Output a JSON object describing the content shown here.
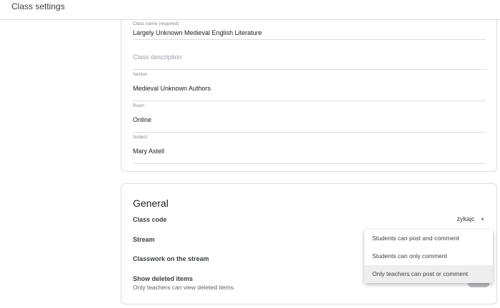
{
  "header": {
    "title": "Class settings"
  },
  "details": {
    "fields": [
      {
        "label": "Class name (required)",
        "value": "Largely Unknown Medieval English Literature"
      },
      {
        "label": "",
        "placeholder": "Class description"
      },
      {
        "label": "Section",
        "value": "Medieval Unknown Authors"
      },
      {
        "label": "Room",
        "value": "Online"
      },
      {
        "label": "Subject",
        "value": "Mary Astell"
      }
    ]
  },
  "general": {
    "title": "General",
    "class_code_label": "Class code",
    "class_code_value": "zykajc",
    "stream_label": "Stream",
    "classwork_label": "Classwork on the stream",
    "show_deleted_label": "Show deleted items",
    "show_deleted_sub": "Only teachers can view deleted items."
  },
  "stream_menu": {
    "options": [
      "Students can post and comment",
      "Students can only comment",
      "Only teachers can post or comment"
    ],
    "selected": "Only teachers can post or comment"
  }
}
